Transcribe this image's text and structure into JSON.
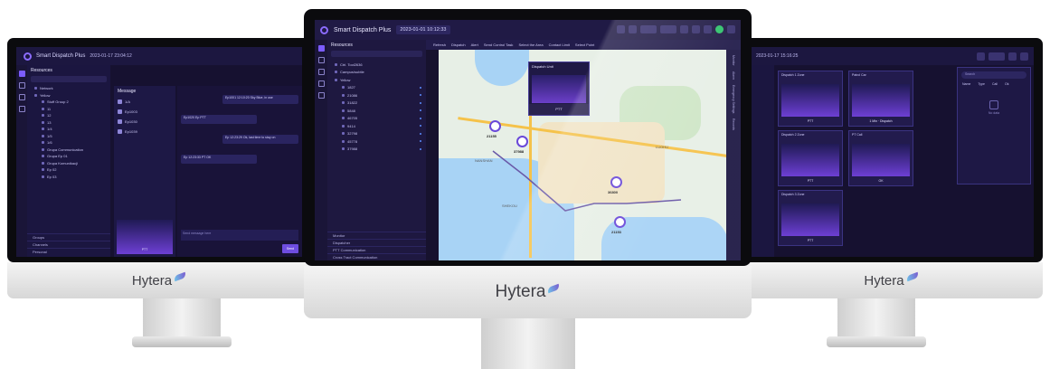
{
  "brand": "Hytera",
  "center_app": {
    "title": "Smart Dispatch Plus",
    "datetime": "2023-01-01 10:12:33",
    "panel_title": "Resources",
    "toolbar": [
      "Refresh",
      "Dispatch",
      "Alert",
      "Send Control Task",
      "Select the Area",
      "Contact Limit",
      "Select Point"
    ],
    "tree": [
      {
        "label": "Ctrl. Tool2636",
        "level": 1
      },
      {
        "label": "Campus/subtle",
        "level": 1
      },
      {
        "label": "Yellow",
        "level": 1
      },
      {
        "label": "1827",
        "level": 2
      },
      {
        "label": "21086",
        "level": 2
      },
      {
        "label": "31822",
        "level": 2
      },
      {
        "label": "5848",
        "level": 2
      },
      {
        "label": "46705",
        "level": 2
      },
      {
        "label": "9414",
        "level": 2
      },
      {
        "label": "32798",
        "level": 2
      },
      {
        "label": "45778",
        "level": 2
      },
      {
        "label": "37988",
        "level": 2
      }
    ],
    "sections": [
      "Monitor",
      "Dispatcher",
      "PTT Communication",
      "Cross Tract Communication"
    ],
    "side_tabs": [
      "Monitor",
      "Alarm",
      "Emergency Settings",
      "Records"
    ],
    "ptt_popup": {
      "title": "Dispatch Unit",
      "button": "PTT"
    },
    "map_labels": [
      "WALNUT",
      "NANSHAN",
      "SHEKOU",
      "FUTIAN",
      "LUOHU",
      "BAYVIEW"
    ],
    "units": [
      "21155",
      "37988",
      "36800",
      "21153"
    ]
  },
  "left_app": {
    "title": "Smart Dispatch Plus",
    "datetime": "2023-01-17 23:04:12",
    "panel_title": "Resources",
    "tree": [
      "Network",
      "Yellow",
      "Stuff Group 2",
      "11",
      "12",
      "13",
      "1/4",
      "1/5",
      "1/6",
      "Grupa Communication",
      "Grupa Ep 01",
      "Grupa Komunikacji",
      "Ep 02",
      "Ep 03"
    ],
    "footer_sections": [
      "Groups",
      "Channels",
      "Personal"
    ],
    "message_title": "Message",
    "contacts": [
      "1/A",
      "Ep1003",
      "Ep1030",
      "Ep1039"
    ],
    "messages": [
      "Ep1001 12:10:20 Sky Blue, in use",
      "Ep1020 Ep PTT",
      "Ep 12:23:29 Ok, last time to stay on",
      "Ep 12:23:33 PT OK"
    ],
    "call_button": "PTT",
    "send_placeholder": "Send message here",
    "send_button": "Send"
  },
  "right_app": {
    "datetime": "2023-01-17 15:16:25",
    "cards": [
      {
        "title": "Dispatch 1 Zone",
        "foot": "PTT"
      },
      {
        "title": "Patrol Car",
        "foot": "1 Min · Dispatch"
      },
      {
        "title": "Dispatch 2 Zone",
        "foot": "PTT"
      },
      {
        "title": "PT Call",
        "foot": "OK"
      },
      {
        "title": "Dispatch 3 Zone",
        "foot": "PTT"
      }
    ],
    "search_placeholder": "Search",
    "table_headers": [
      "Name",
      "Type",
      "Call",
      "Ok"
    ],
    "empty_state": "No data"
  }
}
